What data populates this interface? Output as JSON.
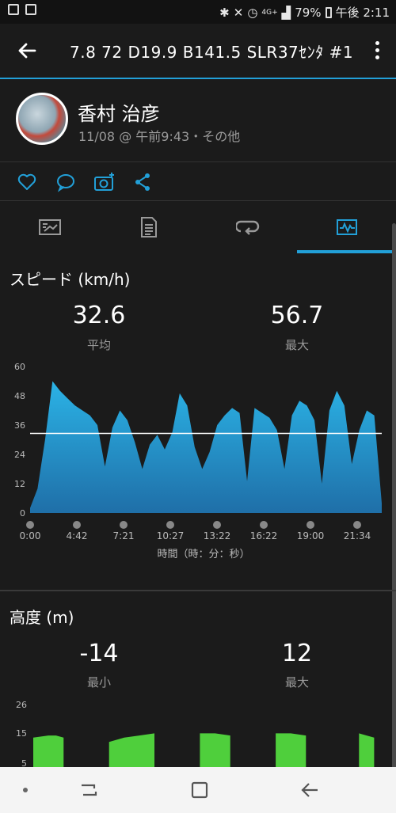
{
  "status_bar": {
    "battery": "79%",
    "time": "午後 2:11",
    "network": "4G+"
  },
  "app_bar": {
    "title": "7.8  72   D19.9  B141.5  SLR37ｾﾝﾀ #1"
  },
  "profile": {
    "name": "香村 治彦",
    "date": "11/08 @ 午前9:43・その他"
  },
  "actions": [
    "heart-icon",
    "comment-icon",
    "camera-add-icon",
    "share-icon"
  ],
  "tabs": [
    {
      "icon": "summary-icon"
    },
    {
      "icon": "details-icon"
    },
    {
      "icon": "laps-icon"
    },
    {
      "icon": "charts-icon",
      "active": true
    }
  ],
  "speed": {
    "title": "スピード (km/h)",
    "avg_value": "32.6",
    "avg_label": "平均",
    "max_value": "56.7",
    "max_label": "最大",
    "x_axis_label": "時間（時：分：秒）"
  },
  "altitude": {
    "title": "高度 (m)",
    "min_value": "-14",
    "min_label": "最小",
    "max_value": "12",
    "max_label": "最大"
  },
  "colors": {
    "accent": "#22a0d8",
    "speed_top": "#2bb3e6",
    "speed_bottom": "#1f6fa8",
    "altitude_fill": "#4fcf3c"
  },
  "chart_data": [
    {
      "type": "area",
      "title": "スピード (km/h)",
      "xlabel": "時間（時：分：秒）",
      "ylabel": "",
      "ylim": [
        0,
        60
      ],
      "y_ticks": [
        0,
        12,
        24,
        36,
        48,
        60
      ],
      "x_tick_labels": [
        "0:00",
        "4:42",
        "7:21",
        "10:27",
        "13:22",
        "16:22",
        "19:00",
        "21:34"
      ],
      "average_line": 32.6,
      "series": [
        {
          "x": [
            0,
            0.5,
            1,
            1.5,
            2,
            2.5,
            3,
            3.5,
            4,
            4.5,
            5,
            5.5,
            6,
            6.5,
            7,
            7.5,
            8,
            8.5,
            9,
            9.5,
            10,
            10.5,
            11,
            11.5,
            12,
            12.5,
            13,
            13.5,
            14,
            14.5,
            15,
            15.5,
            16,
            16.5,
            17,
            17.5,
            18,
            18.5,
            19,
            19.5,
            20,
            20.5,
            21,
            21.5,
            22,
            22.5,
            23,
            23.5
          ],
          "values": [
            2,
            10,
            30,
            54,
            50,
            47,
            44,
            42,
            40,
            36,
            19,
            35,
            42,
            38,
            29,
            18,
            28,
            32,
            26,
            33,
            49,
            44,
            27,
            18,
            25,
            36,
            40,
            43,
            41,
            13,
            43,
            41,
            39,
            34,
            18,
            40,
            46,
            44,
            38,
            12,
            42,
            50,
            44,
            20,
            34,
            42,
            40,
            4
          ]
        }
      ]
    },
    {
      "type": "area",
      "title": "高度 (m)",
      "xlabel": "",
      "ylabel": "",
      "y_tick_labels": [
        "26",
        "15",
        "5"
      ],
      "series": [
        {
          "x": [
            0,
            1,
            1.5,
            2,
            2.5,
            4.5,
            5,
            6,
            7,
            8,
            10,
            10.5,
            11,
            12,
            13,
            15,
            15.5,
            16,
            17,
            18,
            20,
            21,
            21.5,
            22,
            22.5,
            23
          ],
          "values": [
            6,
            7,
            7,
            6,
            null,
            null,
            4,
            6,
            7,
            8,
            null,
            null,
            8,
            8,
            7,
            null,
            null,
            8,
            8,
            7,
            null,
            null,
            8,
            7,
            6,
            null
          ]
        }
      ]
    }
  ]
}
